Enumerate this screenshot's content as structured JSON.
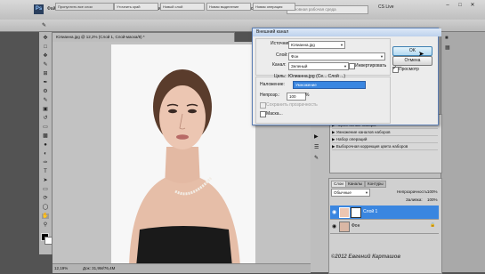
{
  "menubar": {
    "items": [
      "Файл",
      "Редактирование",
      "Изображение",
      "Слои",
      "Выделение",
      "Фильтр",
      "Анализ",
      "3D",
      "Просмотр",
      "Окно",
      "Справка"
    ],
    "workspace": "Основная рабочая среда",
    "cslive": "CS Live"
  },
  "options": {
    "smooth": "Ремешки",
    "fields": [
      "Пропустить все слои",
      "Уточнить край",
      "Новый слой",
      "Новая выделение",
      "Новая операция"
    ]
  },
  "doc_tab": "Юлианна.jpg @ 12,2% (Слой 1, Слой-маска/8) *",
  "status": {
    "zoom": "12,19%",
    "doc": "Док: 31,9M/76,4M"
  },
  "dialog": {
    "title": "Внешний канал",
    "source_label": "Источник:",
    "source_value": "Юлианна.jpg",
    "layer_label": "Слой:",
    "layer_value": "Фон",
    "channel_label": "Канал:",
    "channel_value": "Зеленый",
    "invert_label": "Инвертировать",
    "target_label": "Цель:",
    "target_value": "Юлианна.jpg (Се... Слой ...)",
    "blend_label": "Наложение:",
    "blend_value": "Умножение",
    "opacity_label": "Непрозр.:",
    "opacity_value": "100",
    "opacity_unit": "%",
    "preserve_label": "Сохранить прозрачность",
    "mask_label": "Маска...",
    "ok": "OK",
    "cancel": "Отмена",
    "preview_label": "Просмотр"
  },
  "actions": {
    "items": [
      "Черно-белые наборы",
      "Умножение каналов наборов",
      "Набор операций",
      "Выборочная коррекция цвета наборов"
    ]
  },
  "layers": {
    "tabs": [
      "Слои",
      "Каналы",
      "Контуры"
    ],
    "blend_mode": "Обычные",
    "opacity_label": "Непрозрачность:",
    "opacity_value": "100%",
    "fill_label": "Заливка:",
    "fill_value": "100%",
    "rows": [
      {
        "name": "Слой 1"
      },
      {
        "name": "Фон"
      }
    ]
  },
  "watermark": "©2012 Евгений Карташов",
  "colors": {
    "selection": "#3a86e0",
    "dialog_bg": "#ececec",
    "ps_logo": "#2a3f5e"
  }
}
